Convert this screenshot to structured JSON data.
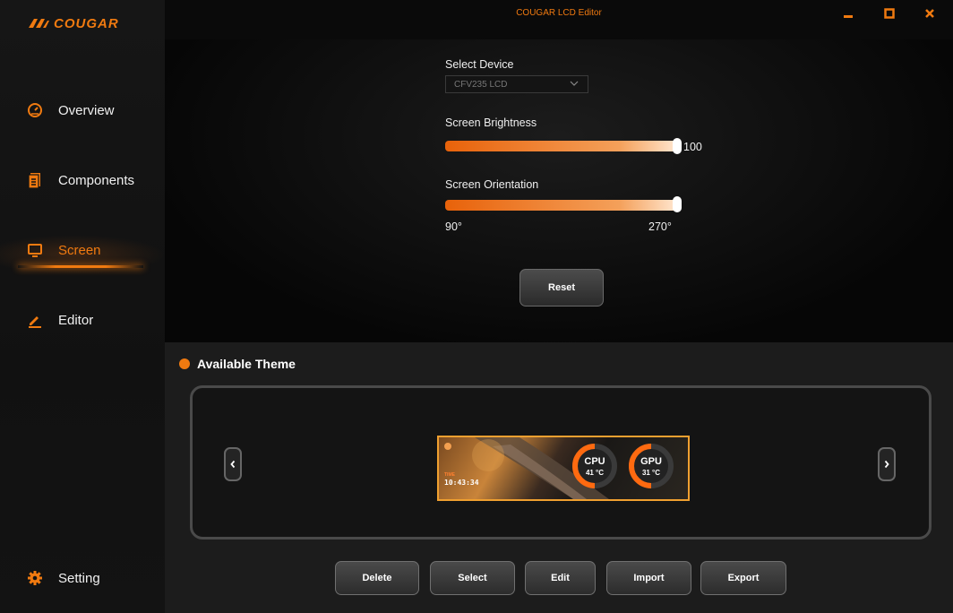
{
  "app": {
    "logo_text": "COUGAR",
    "title": "COUGAR LCD Editor"
  },
  "sidebar": {
    "items": [
      {
        "label": "Overview",
        "icon": "speedometer-icon"
      },
      {
        "label": "Components",
        "icon": "document-icon"
      },
      {
        "label": "Screen",
        "icon": "monitor-icon",
        "active": true
      },
      {
        "label": "Editor",
        "icon": "pen-icon"
      }
    ],
    "setting_label": "Setting"
  },
  "device": {
    "label": "Select Device",
    "selected": "CFV235 LCD"
  },
  "brightness": {
    "label": "Screen Brightness",
    "value": "100",
    "fraction": 1.0
  },
  "orientation": {
    "label": "Screen Orientation",
    "min_label": "90°",
    "max_label": "270°",
    "fraction": 1.0
  },
  "reset_label": "Reset",
  "themes": {
    "header": "Available Theme",
    "card": {
      "time_label": "TIME",
      "time": "10:43:34",
      "cpu_name": "CPU",
      "cpu_temp": "41 °C",
      "gpu_name": "GPU",
      "gpu_temp": "31 °C"
    }
  },
  "actions": {
    "delete": "Delete",
    "select": "Select",
    "edit": "Edit",
    "import": "Import",
    "export": "Export"
  },
  "colors": {
    "accent": "#f07a10",
    "background": "#0c0c0c",
    "panel": "#1c1c1c"
  }
}
